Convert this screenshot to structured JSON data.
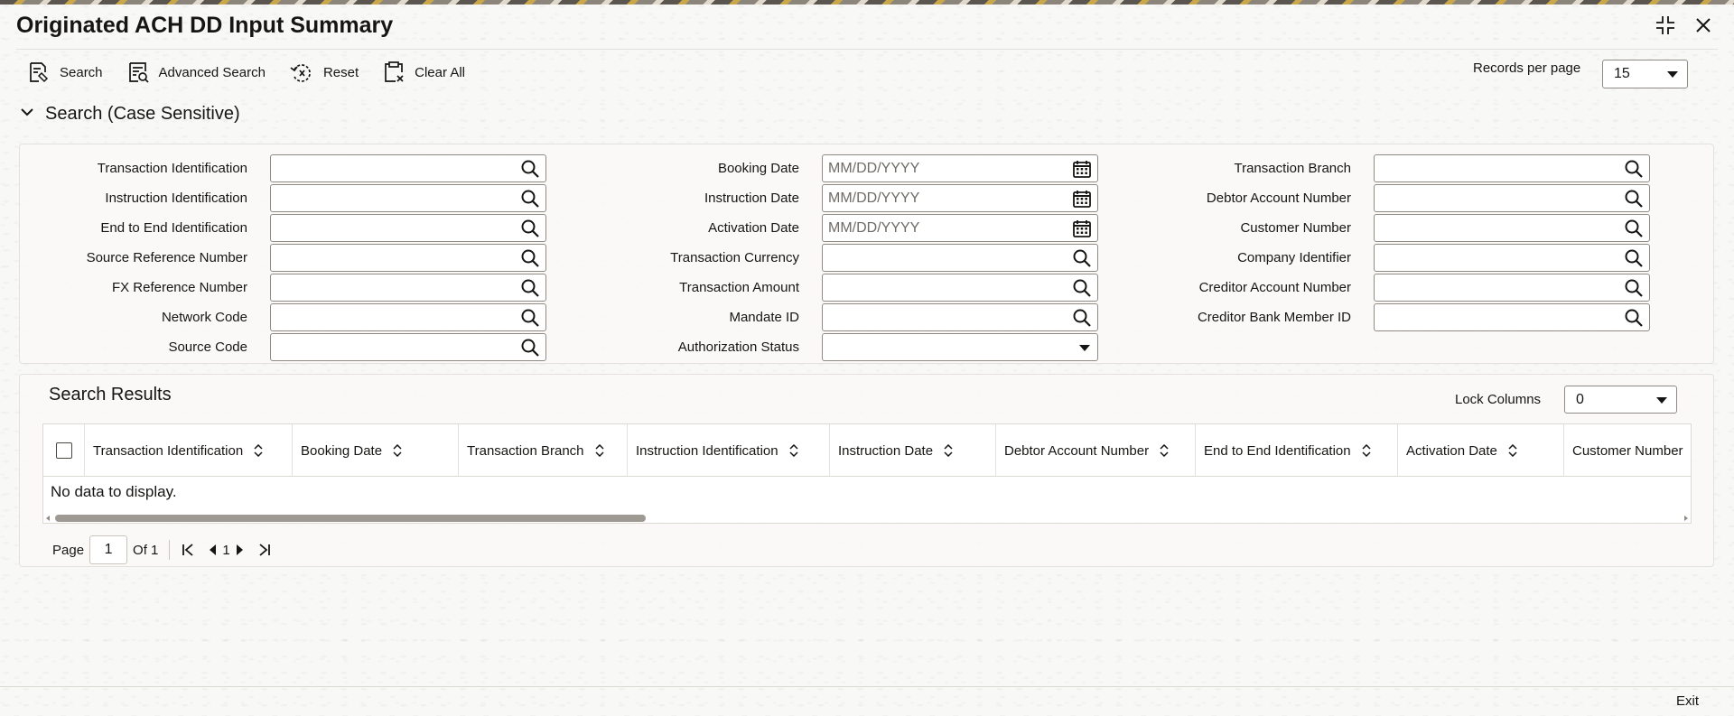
{
  "window": {
    "title": "Originated ACH DD Input Summary",
    "controls": [
      "collapse-icon",
      "close-icon"
    ]
  },
  "toolbar": {
    "search": "Search",
    "advanced_search": "Advanced Search",
    "reset": "Reset",
    "clear_all": "Clear All"
  },
  "records_per_page": {
    "label": "Records per page",
    "value": "15"
  },
  "search_section": {
    "title": "Search (Case Sensitive)",
    "col1": [
      {
        "label": "Transaction Identification",
        "value": "",
        "icon": "search-icon"
      },
      {
        "label": "Instruction Identification",
        "value": "",
        "icon": "search-icon"
      },
      {
        "label": "End to End Identification",
        "value": "",
        "icon": "search-icon"
      },
      {
        "label": "Source Reference Number",
        "value": "",
        "icon": "search-icon"
      },
      {
        "label": "FX Reference Number",
        "value": "",
        "icon": "search-icon"
      },
      {
        "label": "Network Code",
        "value": "",
        "icon": "search-icon"
      },
      {
        "label": "Source Code",
        "value": "",
        "icon": "search-icon"
      }
    ],
    "col2": [
      {
        "label": "Booking Date",
        "placeholder": "MM/DD/YYYY",
        "icon": "calendar-icon"
      },
      {
        "label": "Instruction Date",
        "placeholder": "MM/DD/YYYY",
        "icon": "calendar-icon"
      },
      {
        "label": "Activation Date",
        "placeholder": "MM/DD/YYYY",
        "icon": "calendar-icon"
      },
      {
        "label": "Transaction Currency",
        "placeholder": "",
        "icon": "search-icon"
      },
      {
        "label": "Transaction Amount",
        "placeholder": "",
        "icon": "search-icon"
      },
      {
        "label": "Mandate ID",
        "placeholder": "",
        "icon": "search-icon"
      },
      {
        "label": "Authorization Status",
        "placeholder": "",
        "icon": "dropdown"
      }
    ],
    "col3": [
      {
        "label": "Transaction Branch",
        "value": "",
        "icon": "search-icon"
      },
      {
        "label": "Debtor Account Number",
        "value": "",
        "icon": "search-icon"
      },
      {
        "label": "Customer Number",
        "value": "",
        "icon": "search-icon"
      },
      {
        "label": "Company Identifier",
        "value": "",
        "icon": "search-icon"
      },
      {
        "label": "Creditor Account Number",
        "value": "",
        "icon": "search-icon"
      },
      {
        "label": "Creditor Bank Member ID",
        "value": "",
        "icon": "search-icon"
      }
    ]
  },
  "results": {
    "title": "Search Results",
    "lock_columns": {
      "label": "Lock Columns",
      "value": "0"
    },
    "columns": [
      "Transaction Identification",
      "Booking Date",
      "Transaction Branch",
      "Instruction Identification",
      "Instruction Date",
      "Debtor Account Number",
      "End to End Identification",
      "Activation Date",
      "Customer Number"
    ],
    "empty_text": "No data to display."
  },
  "pagination": {
    "page_label": "Page",
    "current_page": "1",
    "of_label": "Of 1",
    "page_number": "1"
  },
  "footer": {
    "exit": "Exit"
  }
}
